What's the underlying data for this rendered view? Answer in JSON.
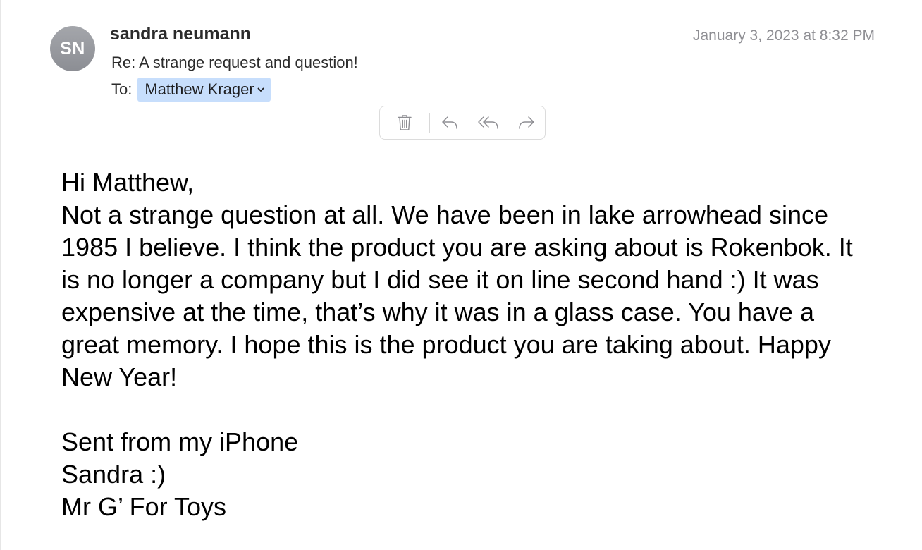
{
  "message": {
    "avatar_initials": "SN",
    "sender_name": "sandra neumann",
    "date": "January 3, 2023 at 8:32 PM",
    "subject": "Re: A strange request and question!",
    "to_label": "To:",
    "recipient": "Matthew Krager"
  },
  "toolbar": {
    "icons": [
      "trash-icon",
      "reply-icon",
      "reply-all-icon",
      "forward-icon"
    ]
  },
  "body": {
    "greeting": "Hi Matthew,",
    "paragraph": "Not a strange question at all. We have been in lake arrowhead since 1985 I believe. I think the product you are asking about is Rokenbok. It is no longer a company but I did see it on line second hand :) It was expensive at the time, that’s why it was in a glass case. You have a great memory. I hope this is the product you are taking about. Happy New Year!",
    "signature_lines": [
      "Sent from my iPhone",
      "Sandra :)",
      "Mr G’ For Toys"
    ]
  },
  "colors": {
    "recipient_highlight": "#c7defc",
    "avatar_gray": "#9a9ca1",
    "secondary_text": "#8e8e93"
  }
}
